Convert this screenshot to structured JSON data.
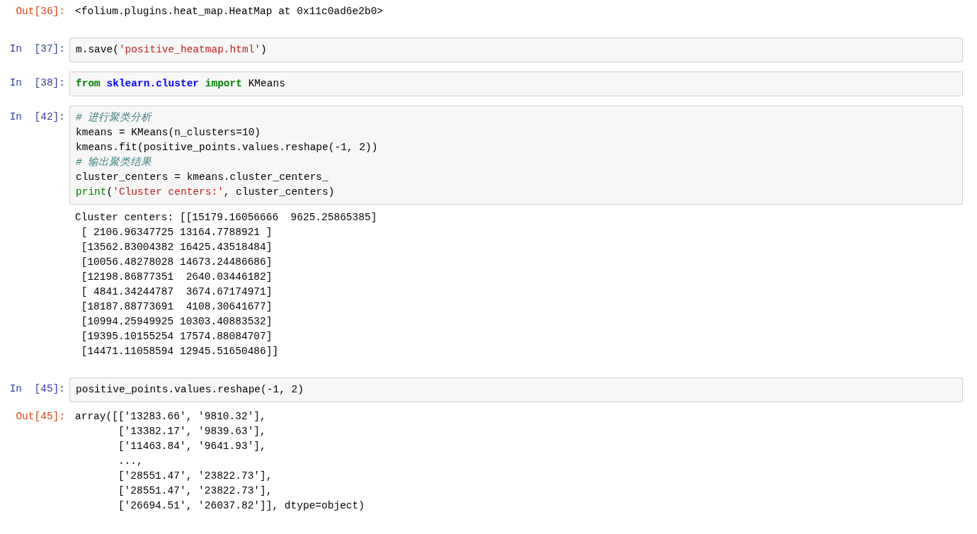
{
  "cells": [
    {
      "kind": "output",
      "prompt": "Out[36]:",
      "lines": [
        [
          {
            "kind": "plain",
            "text": "<folium.plugins.heat_map.HeatMap at 0x11c0ad6e2b0>"
          }
        ]
      ]
    },
    {
      "kind": "input",
      "prompt": "In  [37]:",
      "lines": [
        [
          {
            "kind": "plain",
            "text": "m.save("
          },
          {
            "kind": "string",
            "text": "'positive_heatmap.html'"
          },
          {
            "kind": "plain",
            "text": ")"
          }
        ]
      ]
    },
    {
      "kind": "input",
      "prompt": "In  [38]:",
      "lines": [
        [
          {
            "kind": "keyword",
            "text": "from"
          },
          {
            "kind": "module",
            "text": " sklearn.cluster "
          },
          {
            "kind": "keyword",
            "text": "import"
          },
          {
            "kind": "plain",
            "text": " KMeans"
          }
        ]
      ]
    },
    {
      "kind": "input",
      "prompt": "In  [42]:",
      "lines": [
        [
          {
            "kind": "comment",
            "text": "# 进行聚类分析"
          }
        ],
        [
          {
            "kind": "plain",
            "text": "kmeans = KMeans(n_clusters=10)"
          }
        ],
        [
          {
            "kind": "plain",
            "text": "kmeans.fit(positive_points.values.reshape(-1, 2))"
          }
        ],
        [
          {
            "kind": "comment",
            "text": "# 输出聚类结果"
          }
        ],
        [
          {
            "kind": "plain",
            "text": "cluster_centers = kmeans.cluster_centers_"
          }
        ],
        [
          {
            "kind": "builtin",
            "text": "print"
          },
          {
            "kind": "plain",
            "text": "("
          },
          {
            "kind": "string",
            "text": "'Cluster centers:'"
          },
          {
            "kind": "plain",
            "text": ", cluster_centers)"
          }
        ]
      ]
    },
    {
      "kind": "stream",
      "lines": [
        [
          {
            "kind": "plain",
            "text": "Cluster centers: [[15179.16056666  9625.25865385]"
          }
        ],
        [
          {
            "kind": "plain",
            "text": " [ 2106.96347725 13164.7788921 ]"
          }
        ],
        [
          {
            "kind": "plain",
            "text": " [13562.83004382 16425.43518484]"
          }
        ],
        [
          {
            "kind": "plain",
            "text": " [10056.48278028 14673.24486686]"
          }
        ],
        [
          {
            "kind": "plain",
            "text": " [12198.86877351  2640.03446182]"
          }
        ],
        [
          {
            "kind": "plain",
            "text": " [ 4841.34244787  3674.67174971]"
          }
        ],
        [
          {
            "kind": "plain",
            "text": " [18187.88773691  4108.30641677]"
          }
        ],
        [
          {
            "kind": "plain",
            "text": " [10994.25949925 10303.40883532]"
          }
        ],
        [
          {
            "kind": "plain",
            "text": " [19395.10155254 17574.88084707]"
          }
        ],
        [
          {
            "kind": "plain",
            "text": " [14471.11058594 12945.51650486]]"
          }
        ]
      ]
    },
    {
      "kind": "input",
      "prompt": "In  [45]:",
      "lines": [
        [
          {
            "kind": "plain",
            "text": "positive_points.values.reshape(-1, 2)"
          }
        ]
      ]
    },
    {
      "kind": "output",
      "prompt": "Out[45]:",
      "lines": [
        [
          {
            "kind": "plain",
            "text": "array([['13283.66', '9810.32'],"
          }
        ],
        [
          {
            "kind": "plain",
            "text": "       ['13382.17', '9839.63'],"
          }
        ],
        [
          {
            "kind": "plain",
            "text": "       ['11463.84', '9641.93'],"
          }
        ],
        [
          {
            "kind": "plain",
            "text": "       ...,"
          }
        ],
        [
          {
            "kind": "plain",
            "text": "       ['28551.47', '23822.73'],"
          }
        ],
        [
          {
            "kind": "plain",
            "text": "       ['28551.47', '23822.73'],"
          }
        ],
        [
          {
            "kind": "plain",
            "text": "       ['26694.51', '26037.82']], dtype=object)"
          }
        ]
      ]
    }
  ]
}
